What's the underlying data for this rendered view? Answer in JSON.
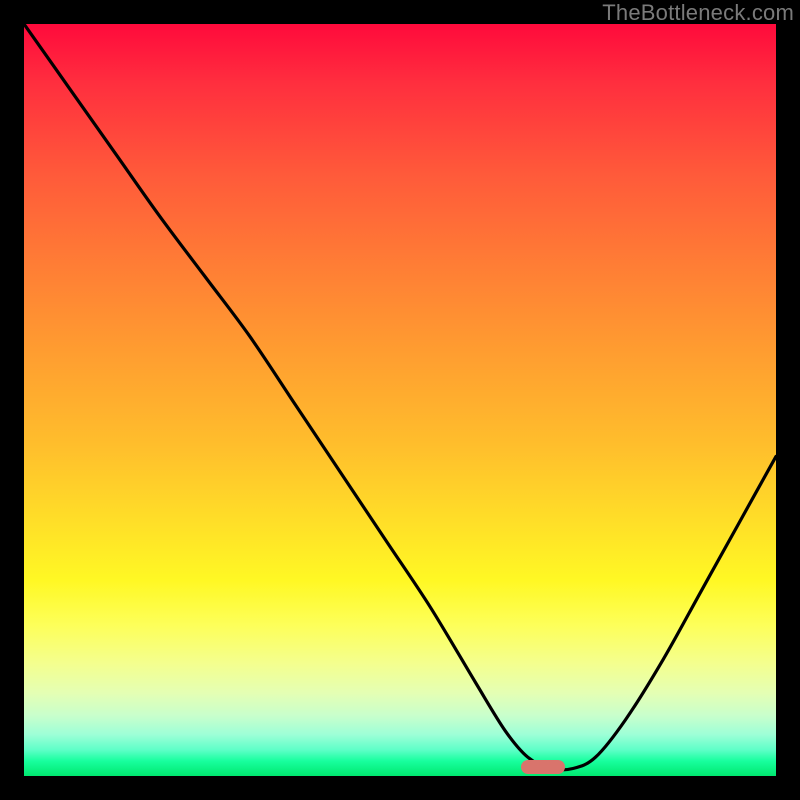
{
  "watermark": "TheBottleneck.com",
  "marker": {
    "x_frac": 0.69,
    "y_frac": 0.992
  },
  "chart_data": {
    "type": "line",
    "title": "",
    "xlabel": "",
    "ylabel": "",
    "xlim": [
      0,
      1
    ],
    "ylim": [
      0,
      1
    ],
    "series": [
      {
        "name": "bottleneck-curve",
        "x": [
          0.0,
          0.06,
          0.12,
          0.18,
          0.24,
          0.3,
          0.36,
          0.42,
          0.48,
          0.54,
          0.6,
          0.64,
          0.67,
          0.7,
          0.73,
          0.76,
          0.8,
          0.85,
          0.9,
          0.95,
          1.0
        ],
        "y": [
          1.0,
          0.915,
          0.83,
          0.745,
          0.665,
          0.585,
          0.495,
          0.405,
          0.315,
          0.225,
          0.125,
          0.06,
          0.025,
          0.01,
          0.01,
          0.025,
          0.075,
          0.155,
          0.245,
          0.335,
          0.425
        ]
      }
    ],
    "annotations": [
      {
        "type": "marker",
        "shape": "pill",
        "x": 0.69,
        "y": 0.008,
        "color": "#d9746c"
      }
    ],
    "background_gradient": {
      "direction": "vertical",
      "stops": [
        {
          "pos": 0.0,
          "color": "#ff0a3c"
        },
        {
          "pos": 0.5,
          "color": "#ffbe2c"
        },
        {
          "pos": 0.8,
          "color": "#fdff5a"
        },
        {
          "pos": 1.0,
          "color": "#00e86f"
        }
      ]
    }
  }
}
